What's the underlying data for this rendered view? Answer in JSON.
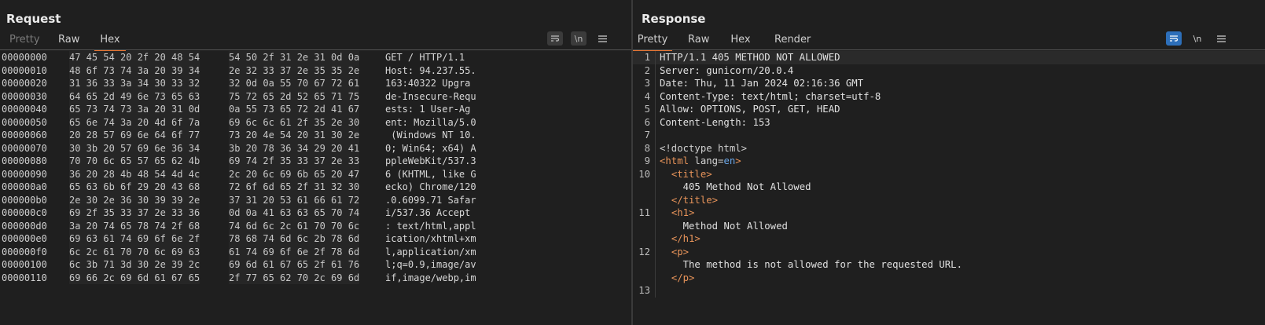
{
  "request": {
    "title": "Request",
    "tabs": [
      "Pretty",
      "Raw",
      "Hex"
    ],
    "active_tab": "Hex",
    "hex_rows": [
      {
        "offset": "00000000",
        "bytes1": "47 45 54 20 2f 20 48 54",
        "bytes2": "54 50 2f 31 2e 31 0d 0a",
        "ascii": "GET / HTTP/1.1"
      },
      {
        "offset": "00000010",
        "bytes1": "48 6f 73 74 3a 20 39 34",
        "bytes2": "2e 32 33 37 2e 35 35 2e",
        "ascii": "Host: 94.237.55."
      },
      {
        "offset": "00000020",
        "bytes1": "31 36 33 3a 34 30 33 32",
        "bytes2": "32 0d 0a 55 70 67 72 61",
        "ascii": "163:40322 Upgra"
      },
      {
        "offset": "00000030",
        "bytes1": "64 65 2d 49 6e 73 65 63",
        "bytes2": "75 72 65 2d 52 65 71 75",
        "ascii": "de-Insecure-Requ"
      },
      {
        "offset": "00000040",
        "bytes1": "65 73 74 73 3a 20 31 0d",
        "bytes2": "0a 55 73 65 72 2d 41 67",
        "ascii": "ests: 1 User-Ag"
      },
      {
        "offset": "00000050",
        "bytes1": "65 6e 74 3a 20 4d 6f 7a",
        "bytes2": "69 6c 6c 61 2f 35 2e 30",
        "ascii": "ent: Mozilla/5.0"
      },
      {
        "offset": "00000060",
        "bytes1": "20 28 57 69 6e 64 6f 77",
        "bytes2": "73 20 4e 54 20 31 30 2e",
        "ascii": " (Windows NT 10."
      },
      {
        "offset": "00000070",
        "bytes1": "30 3b 20 57 69 6e 36 34",
        "bytes2": "3b 20 78 36 34 29 20 41",
        "ascii": "0; Win64; x64) A"
      },
      {
        "offset": "00000080",
        "bytes1": "70 70 6c 65 57 65 62 4b",
        "bytes2": "69 74 2f 35 33 37 2e 33",
        "ascii": "ppleWebKit/537.3"
      },
      {
        "offset": "00000090",
        "bytes1": "36 20 28 4b 48 54 4d 4c",
        "bytes2": "2c 20 6c 69 6b 65 20 47",
        "ascii": "6 (KHTML, like G"
      },
      {
        "offset": "000000a0",
        "bytes1": "65 63 6b 6f 29 20 43 68",
        "bytes2": "72 6f 6d 65 2f 31 32 30",
        "ascii": "ecko) Chrome/120"
      },
      {
        "offset": "000000b0",
        "bytes1": "2e 30 2e 36 30 39 39 2e",
        "bytes2": "37 31 20 53 61 66 61 72",
        "ascii": ".0.6099.71 Safar"
      },
      {
        "offset": "000000c0",
        "bytes1": "69 2f 35 33 37 2e 33 36",
        "bytes2": "0d 0a 41 63 63 65 70 74",
        "ascii": "i/537.36 Accept"
      },
      {
        "offset": "000000d0",
        "bytes1": "3a 20 74 65 78 74 2f 68",
        "bytes2": "74 6d 6c 2c 61 70 70 6c",
        "ascii": ": text/html,appl"
      },
      {
        "offset": "000000e0",
        "bytes1": "69 63 61 74 69 6f 6e 2f",
        "bytes2": "78 68 74 6d 6c 2b 78 6d",
        "ascii": "ication/xhtml+xm"
      },
      {
        "offset": "000000f0",
        "bytes1": "6c 2c 61 70 70 6c 69 63",
        "bytes2": "61 74 69 6f 6e 2f 78 6d",
        "ascii": "l,application/xm"
      },
      {
        "offset": "00000100",
        "bytes1": "6c 3b 71 3d 30 2e 39 2c",
        "bytes2": "69 6d 61 67 65 2f 61 76",
        "ascii": "l;q=0.9,image/av"
      },
      {
        "offset": "00000110",
        "bytes1": "69 66 2c 69 6d 61 67 65",
        "bytes2": "2f 77 65 62 70 2c 69 6d",
        "ascii": "if,image/webp,im"
      }
    ]
  },
  "response": {
    "title": "Response",
    "tabs": [
      "Pretty",
      "Raw",
      "Hex",
      "Render"
    ],
    "active_tab": "Pretty",
    "lines": [
      {
        "n": "1",
        "kind": "text",
        "text": "HTTP/1.1 405 METHOD NOT ALLOWED"
      },
      {
        "n": "2",
        "kind": "text",
        "text": "Server: gunicorn/20.0.4"
      },
      {
        "n": "3",
        "kind": "text",
        "text": "Date: Thu, 11 Jan 2024 02:16:36 GMT"
      },
      {
        "n": "4",
        "kind": "text",
        "text": "Content-Type: text/html; charset=utf-8"
      },
      {
        "n": "5",
        "kind": "text",
        "text": "Allow: OPTIONS, POST, GET, HEAD"
      },
      {
        "n": "6",
        "kind": "text",
        "text": "Content-Length: 153"
      },
      {
        "n": "7",
        "kind": "text",
        "text": ""
      },
      {
        "n": "8",
        "kind": "doc",
        "text": "<!doctype html>"
      },
      {
        "n": "9",
        "kind": "html",
        "open": "<html",
        "attr": " lang=",
        "val": "en",
        "close": ">"
      },
      {
        "n": "10",
        "kind": "tag",
        "indent": "  ",
        "text": "<title>"
      },
      {
        "n": "",
        "kind": "text",
        "indent": "    ",
        "text": "405 Method Not Allowed"
      },
      {
        "n": "",
        "kind": "tag",
        "indent": "  ",
        "text": "</title>"
      },
      {
        "n": "11",
        "kind": "tag",
        "indent": "  ",
        "text": "<h1>"
      },
      {
        "n": "",
        "kind": "text",
        "indent": "    ",
        "text": "Method Not Allowed"
      },
      {
        "n": "",
        "kind": "tag",
        "indent": "  ",
        "text": "</h1>"
      },
      {
        "n": "12",
        "kind": "tag",
        "indent": "  ",
        "text": "<p>"
      },
      {
        "n": "",
        "kind": "text",
        "indent": "    ",
        "text": "The method is not allowed for the requested URL."
      },
      {
        "n": "",
        "kind": "tag",
        "indent": "  ",
        "text": "</p>"
      },
      {
        "n": "13",
        "kind": "text",
        "text": ""
      }
    ]
  },
  "toolbar": {
    "newline_label": "\\n",
    "menu_icon": "hamburger-menu-icon",
    "wrap_icon": "wrap-lines-icon"
  },
  "layout_icons": [
    "split-columns-icon",
    "split-rows-icon",
    "tabs-layout-icon"
  ],
  "colors": {
    "accent_orange": "#e8742f",
    "active_blue": "#2d6fba",
    "background": "#1f1f1f"
  }
}
